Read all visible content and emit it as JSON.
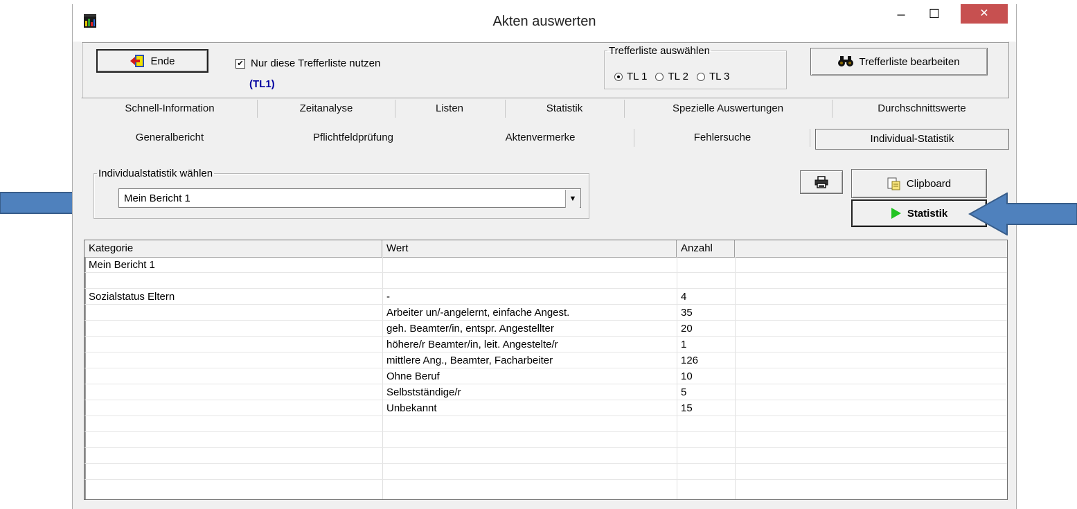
{
  "window": {
    "title": "Akten auswerten",
    "close_glyph": "✕",
    "minimize_glyph": "–",
    "maximize_glyph": "☐"
  },
  "toolbar": {
    "end_label": "Ende",
    "only_hitlist_label": "Nur diese Trefferliste nutzen",
    "only_hitlist_checked": true,
    "hitlist_code": "(TL1)",
    "hitlist_group_label": "Trefferliste auswählen",
    "hitlist_options": [
      "TL 1",
      "TL 2",
      "TL 3"
    ],
    "hitlist_selected": "TL 1",
    "edit_hitlist_label": "Trefferliste bearbeiten"
  },
  "tabs": {
    "row1": [
      "Schnell-Information",
      "Zeitanalyse",
      "Listen",
      "Statistik",
      "Spezielle Auswertungen",
      "Durchschnittswerte"
    ],
    "row2": [
      "Generalbericht",
      "Pflichtfeldprüfung",
      "Aktenvermerke",
      "Fehlersuche",
      "Individual-Statistik"
    ],
    "active": "Individual-Statistik"
  },
  "statistic_panel": {
    "group_label": "Individualstatistik wählen",
    "selected_report": "Mein Bericht 1",
    "clipboard_label": "Clipboard",
    "statistik_label": "Statistik"
  },
  "table": {
    "headers": [
      "Kategorie",
      "Wert",
      "Anzahl"
    ],
    "rows": [
      [
        "Mein Bericht 1",
        "",
        ""
      ],
      [
        "",
        "",
        ""
      ],
      [
        "Sozialstatus Eltern",
        "-",
        "4"
      ],
      [
        "",
        "Arbeiter un/-angelernt, einfache Angest.",
        "35"
      ],
      [
        "",
        "geh. Beamter/in, entspr. Angestellter",
        "20"
      ],
      [
        "",
        "höhere/r Beamter/in, leit. Angestelte/r",
        "1"
      ],
      [
        "",
        "mittlere Ang., Beamter, Facharbeiter",
        "126"
      ],
      [
        "",
        "Ohne Beruf",
        "10"
      ],
      [
        "",
        "Selbstständige/r",
        "5"
      ],
      [
        "",
        "Unbekannt",
        "15"
      ],
      [
        "",
        "",
        ""
      ],
      [
        "",
        "",
        ""
      ],
      [
        "",
        "",
        ""
      ],
      [
        "",
        "",
        ""
      ]
    ]
  },
  "colors": {
    "arrow": "#4f81bd",
    "arrow_border": "#385d8a",
    "close": "#c75050",
    "statistik_play": "#22c322",
    "hitlist_code": "#0000a0"
  }
}
